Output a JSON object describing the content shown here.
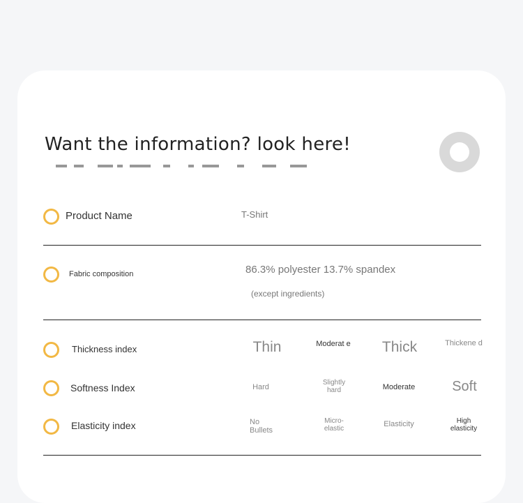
{
  "headline": "Want the information? look here!",
  "product": {
    "name_label": "Product Name",
    "name_value": "T-Shirt"
  },
  "fabric": {
    "label": "Fabric composition",
    "value": "86.3% polyester 13.7% spandex",
    "note": "(except ingredients)"
  },
  "indices": [
    {
      "label": "Thickness index",
      "options": [
        "Thin",
        "Moderat e",
        "Thick",
        "Thickene d"
      ],
      "selected": 0
    },
    {
      "label": "Softness Index",
      "options": [
        "Hard",
        "Slightly hard",
        "Moderate",
        "Soft"
      ],
      "selected": 3
    },
    {
      "label": "Elasticity index",
      "options": [
        "No Bullets",
        "Micro-elastic",
        "Elasticity",
        "High elasticity"
      ],
      "selected": 3
    }
  ],
  "colors": {
    "accent": "#f2b844",
    "ring": "#d9d9d9"
  }
}
